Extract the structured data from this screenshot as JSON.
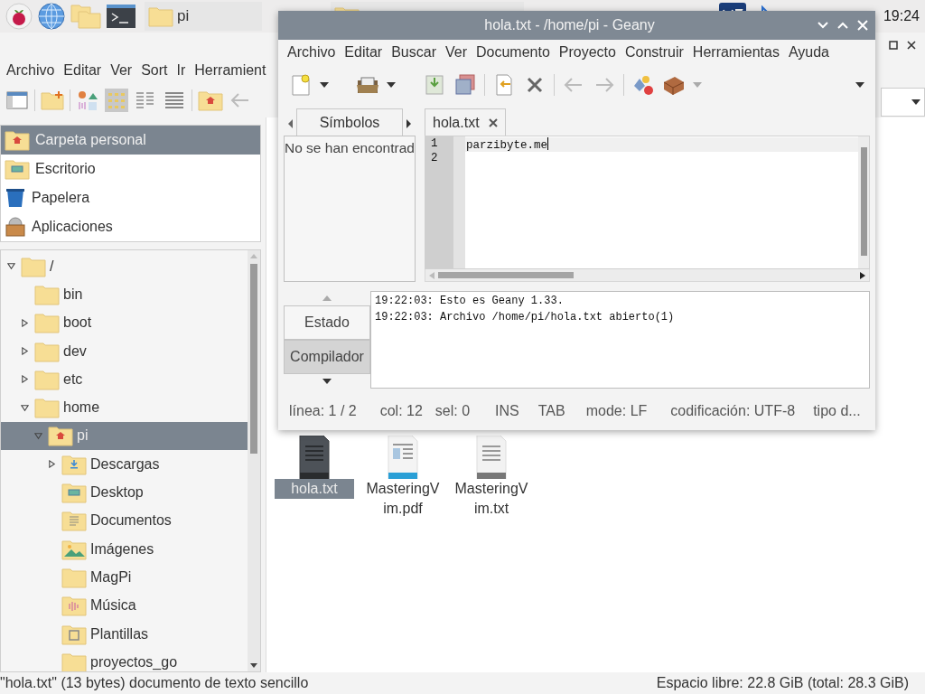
{
  "taskbar": {
    "tasks": [
      {
        "label": "pi",
        "selected": false
      },
      {
        "selected": false
      }
    ],
    "clock": "19:24"
  },
  "file_manager": {
    "menu": [
      "Archivo",
      "Editar",
      "Ver",
      "Sort",
      "Ir",
      "Herramient"
    ],
    "places": [
      {
        "label": "Carpeta personal",
        "kind": "home",
        "selected": true
      },
      {
        "label": "Escritorio",
        "kind": "desktop",
        "selected": false
      },
      {
        "label": "Papelera",
        "kind": "trash",
        "selected": false
      },
      {
        "label": "Aplicaciones",
        "kind": "applications",
        "selected": false
      }
    ],
    "tree": [
      {
        "label": "/",
        "kind": "folder",
        "expanded": true,
        "selected": false,
        "children": [
          {
            "label": "bin",
            "kind": "folder",
            "selected": false
          },
          {
            "label": "boot",
            "kind": "folder",
            "expanded": false,
            "selected": false
          },
          {
            "label": "dev",
            "kind": "folder",
            "expanded": false,
            "selected": false
          },
          {
            "label": "etc",
            "kind": "folder",
            "expanded": false,
            "selected": false
          },
          {
            "label": "home",
            "kind": "folder",
            "expanded": true,
            "selected": false,
            "children": [
              {
                "label": "pi",
                "kind": "home",
                "expanded": true,
                "selected": true,
                "children": [
                  {
                    "label": "Descargas",
                    "kind": "downloads",
                    "expanded": false,
                    "selected": false
                  },
                  {
                    "label": "Desktop",
                    "kind": "desktop",
                    "selected": false
                  },
                  {
                    "label": "Documentos",
                    "kind": "documents",
                    "selected": false
                  },
                  {
                    "label": "Imágenes",
                    "kind": "pictures",
                    "selected": false
                  },
                  {
                    "label": "MagPi",
                    "kind": "folder",
                    "selected": false
                  },
                  {
                    "label": "Música",
                    "kind": "music",
                    "selected": false
                  },
                  {
                    "label": "Plantillas",
                    "kind": "templates",
                    "selected": false
                  },
                  {
                    "label": "proyectos_go",
                    "kind": "folder",
                    "selected": false
                  }
                ]
              }
            ]
          }
        ]
      }
    ],
    "files": [
      {
        "name": "hola.txt",
        "kind": "text",
        "selected": true
      },
      {
        "name": "MasteringVim.pdf",
        "kind": "pdf",
        "selected": false
      },
      {
        "name": "MasteringVim.txt",
        "kind": "text",
        "selected": false
      }
    ],
    "status_left": "\"hola.txt\" (13 bytes) documento de texto sencillo",
    "status_right": "Espacio libre: 22.8 GiB (total: 28.3 GiB)"
  },
  "geany": {
    "title": "hola.txt - /home/pi - Geany",
    "menu": [
      "Archivo",
      "Editar",
      "Buscar",
      "Ver",
      "Documento",
      "Proyecto",
      "Construir",
      "Herramientas",
      "Ayuda"
    ],
    "sidebar_tabs": [
      {
        "label": "Símbolos",
        "selected": true
      }
    ],
    "symbols_message": "No se han encontrad",
    "document_tabs": [
      {
        "label": "hola.txt",
        "selected": true
      }
    ],
    "editor": {
      "lines": [
        {
          "number": "1",
          "text": "parzibyte.me"
        },
        {
          "number": "2"
        }
      ]
    },
    "message_tabs": [
      {
        "label": "Estado",
        "selected": true
      },
      {
        "label": "Compilador",
        "selected": false
      }
    ],
    "messages": [
      "19:22:03: Esto es Geany 1.33.",
      "19:22:03: Archivo /home/pi/hola.txt abierto(1)"
    ],
    "status": [
      "línea: 1 / 2",
      "col: 12",
      "sel: 0",
      "INS",
      "TAB",
      "mode: LF",
      "codificación: UTF-8",
      "tipo d..."
    ]
  }
}
